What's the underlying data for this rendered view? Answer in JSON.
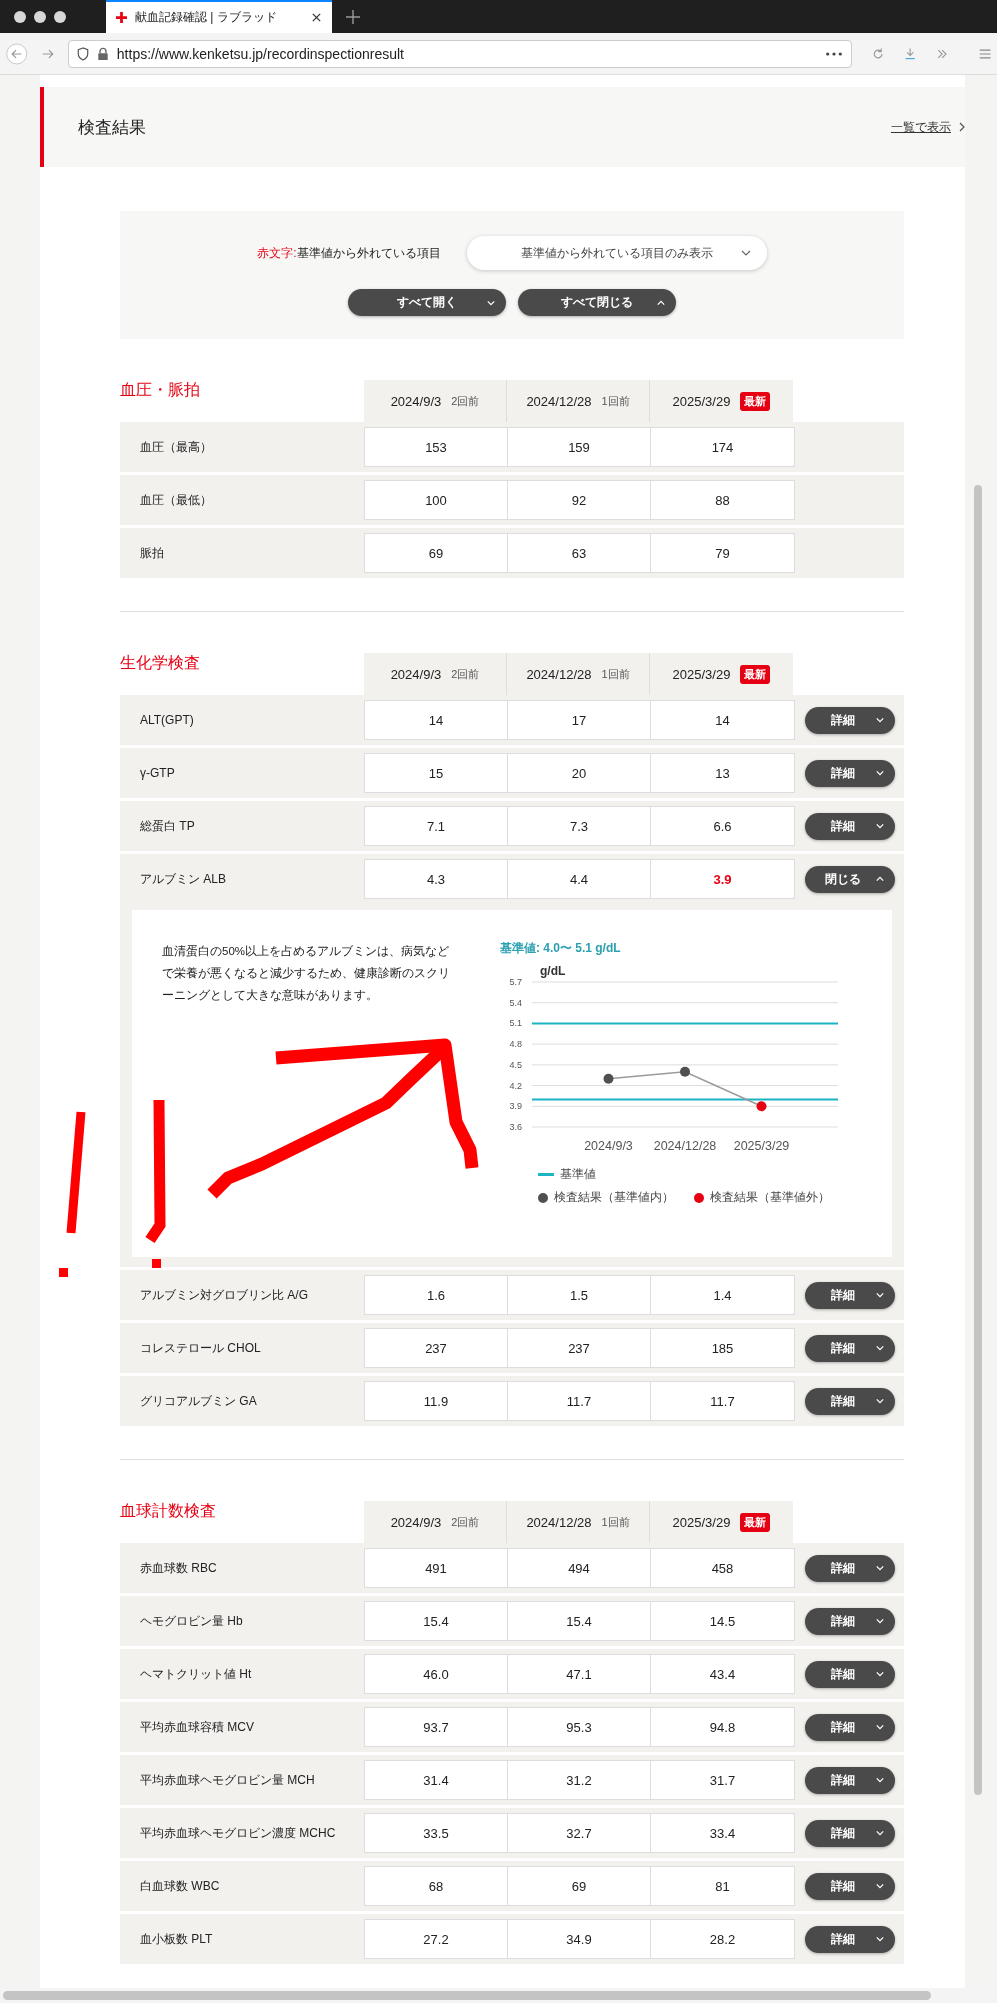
{
  "browser": {
    "tab_title": "献血記録確認 | ラブラッド",
    "url": "https://www.kenketsu.jp/recordinspectionresult"
  },
  "header": {
    "title": "検査結果",
    "link": "一覧で表示"
  },
  "filter": {
    "legend_red": "赤文字:",
    "legend_text": "基準値から外れている項目",
    "dropdown": "基準値から外れている項目のみ表示",
    "buttons": [
      {
        "label": "すべて開く",
        "kind": "open"
      },
      {
        "label": "すべて閉じる",
        "kind": "close"
      }
    ]
  },
  "sections": [
    {
      "title": "血圧・脈拍",
      "dates": [
        {
          "date": "2024/9/3",
          "note": "2回前",
          "kind": "plain"
        },
        {
          "date": "2024/12/28",
          "note": "1回前",
          "kind": "plain"
        },
        {
          "date": "2025/3/29",
          "note": "最新",
          "kind": "badge"
        }
      ],
      "rows": [
        {
          "name": "血圧（最高）",
          "values": [
            {
              "text": "153",
              "out": false
            },
            {
              "text": "159",
              "out": false
            },
            {
              "text": "174",
              "out": false
            }
          ]
        },
        {
          "name": "血圧（最低）",
          "values": [
            {
              "text": "100",
              "out": false
            },
            {
              "text": "92",
              "out": false
            },
            {
              "text": "88",
              "out": false
            }
          ]
        },
        {
          "name": "脈拍",
          "values": [
            {
              "text": "69",
              "out": false
            },
            {
              "text": "63",
              "out": false
            },
            {
              "text": "79",
              "out": false
            }
          ]
        }
      ]
    },
    {
      "title": "生化学検査",
      "dates": [
        {
          "date": "2024/9/3",
          "note": "2回前",
          "kind": "plain"
        },
        {
          "date": "2024/12/28",
          "note": "1回前",
          "kind": "plain"
        },
        {
          "date": "2025/3/29",
          "note": "最新",
          "kind": "badge"
        }
      ],
      "rows": [
        {
          "name": "ALT(GPT)",
          "values": [
            {
              "text": "14",
              "out": false
            },
            {
              "text": "17",
              "out": false
            },
            {
              "text": "14",
              "out": false
            }
          ],
          "button": {
            "label": "詳細",
            "expanded": false
          }
        },
        {
          "name": "γ-GTP",
          "values": [
            {
              "text": "15",
              "out": false
            },
            {
              "text": "20",
              "out": false
            },
            {
              "text": "13",
              "out": false
            }
          ],
          "button": {
            "label": "詳細",
            "expanded": false
          }
        },
        {
          "name": "総蛋白 TP",
          "values": [
            {
              "text": "7.1",
              "out": false
            },
            {
              "text": "7.3",
              "out": false
            },
            {
              "text": "6.6",
              "out": false
            }
          ],
          "button": {
            "label": "詳細",
            "expanded": false
          }
        },
        {
          "name": "アルブミン ALB",
          "values": [
            {
              "text": "4.3",
              "out": false
            },
            {
              "text": "4.4",
              "out": false
            },
            {
              "text": "3.9",
              "out": true
            }
          ],
          "button": {
            "label": "閉じる",
            "expanded": true
          },
          "detail": {
            "description": "血清蛋白の50%以上を占めるアルブミンは、病気などで栄養が悪くなると減少するため、健康診断のスクリーニングとして大きな意味があります。",
            "reference": "基準値: 4.0〜 5.1 g/dL",
            "chart_data": {
              "type": "line",
              "ylabel": "g/dL",
              "categories": [
                "2024/9/3",
                "2024/12/28",
                "2025/3/29"
              ],
              "series": [
                {
                  "color": "#9a9a9a",
                  "values": [
                    4.3,
                    4.4,
                    3.9
                  ],
                  "marker": "o"
                }
              ],
              "ylim": [
                3.6,
                5.7
              ],
              "yticks": [
                3.6,
                3.9,
                4.2,
                4.5,
                4.8,
                5.1,
                5.4,
                5.7
              ],
              "grid": true,
              "ref_lines": [
                {
                  "axis": "y",
                  "value": 4.0,
                  "color": "#1ab4c4"
                },
                {
                  "axis": "y",
                  "value": 5.1,
                  "color": "#1ab4c4"
                }
              ]
            },
            "legend": [
              {
                "kind": "line",
                "label": "基準値",
                "color": "#1ab4c4"
              },
              {
                "kind": "dot",
                "label": "検査結果（基準値内）",
                "color": "#505050"
              },
              {
                "kind": "dot",
                "label": "検査結果（基準値外）",
                "color": "#e60012"
              }
            ]
          }
        },
        {
          "name": "アルブミン対グロブリン比 A/G",
          "values": [
            {
              "text": "1.6",
              "out": false
            },
            {
              "text": "1.5",
              "out": false
            },
            {
              "text": "1.4",
              "out": false
            }
          ],
          "button": {
            "label": "詳細",
            "expanded": false
          }
        },
        {
          "name": "コレステロール CHOL",
          "values": [
            {
              "text": "237",
              "out": false
            },
            {
              "text": "237",
              "out": false
            },
            {
              "text": "185",
              "out": false
            }
          ],
          "button": {
            "label": "詳細",
            "expanded": false
          }
        },
        {
          "name": "グリコアルブミン GA",
          "values": [
            {
              "text": "11.9",
              "out": false
            },
            {
              "text": "11.7",
              "out": false
            },
            {
              "text": "11.7",
              "out": false
            }
          ],
          "button": {
            "label": "詳細",
            "expanded": false
          }
        }
      ]
    },
    {
      "title": "血球計数検査",
      "dates": [
        {
          "date": "2024/9/3",
          "note": "2回前",
          "kind": "plain"
        },
        {
          "date": "2024/12/28",
          "note": "1回前",
          "kind": "plain"
        },
        {
          "date": "2025/3/29",
          "note": "最新",
          "kind": "badge"
        }
      ],
      "rows": [
        {
          "name": "赤血球数 RBC",
          "values": [
            {
              "text": "491",
              "out": false
            },
            {
              "text": "494",
              "out": false
            },
            {
              "text": "458",
              "out": false
            }
          ],
          "button": {
            "label": "詳細",
            "expanded": false
          }
        },
        {
          "name": "ヘモグロビン量 Hb",
          "values": [
            {
              "text": "15.4",
              "out": false
            },
            {
              "text": "15.4",
              "out": false
            },
            {
              "text": "14.5",
              "out": false
            }
          ],
          "button": {
            "label": "詳細",
            "expanded": false
          }
        },
        {
          "name": "ヘマトクリット値 Ht",
          "values": [
            {
              "text": "46.0",
              "out": false
            },
            {
              "text": "47.1",
              "out": false
            },
            {
              "text": "43.4",
              "out": false
            }
          ],
          "button": {
            "label": "詳細",
            "expanded": false
          }
        },
        {
          "name": "平均赤血球容積 MCV",
          "values": [
            {
              "text": "93.7",
              "out": false
            },
            {
              "text": "95.3",
              "out": false
            },
            {
              "text": "94.8",
              "out": false
            }
          ],
          "button": {
            "label": "詳細",
            "expanded": false
          }
        },
        {
          "name": "平均赤血球ヘモグロビン量 MCH",
          "values": [
            {
              "text": "31.4",
              "out": false
            },
            {
              "text": "31.2",
              "out": false
            },
            {
              "text": "31.7",
              "out": false
            }
          ],
          "button": {
            "label": "詳細",
            "expanded": false
          }
        },
        {
          "name": "平均赤血球ヘモグロビン濃度 MCHC",
          "values": [
            {
              "text": "33.5",
              "out": false
            },
            {
              "text": "32.7",
              "out": false
            },
            {
              "text": "33.4",
              "out": false
            }
          ],
          "button": {
            "label": "詳細",
            "expanded": false
          }
        },
        {
          "name": "白血球数 WBC",
          "values": [
            {
              "text": "68",
              "out": false
            },
            {
              "text": "69",
              "out": false
            },
            {
              "text": "81",
              "out": false
            }
          ],
          "button": {
            "label": "詳細",
            "expanded": false
          }
        },
        {
          "name": "血小板数 PLT",
          "values": [
            {
              "text": "27.2",
              "out": false
            },
            {
              "text": "34.9",
              "out": false
            },
            {
              "text": "28.2",
              "out": false
            }
          ],
          "button": {
            "label": "詳細",
            "expanded": false
          }
        }
      ]
    }
  ]
}
